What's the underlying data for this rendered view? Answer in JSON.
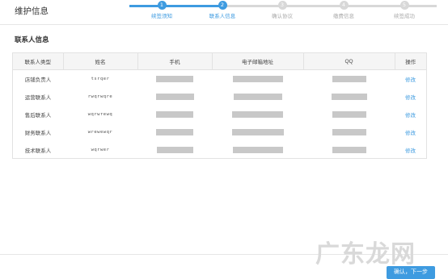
{
  "header": {
    "title": "维护信息"
  },
  "steps": [
    {
      "num": "1",
      "label": "续签须知",
      "active": true
    },
    {
      "num": "2",
      "label": "联系人信息",
      "active": true
    },
    {
      "num": "3",
      "label": "确认协议",
      "active": false
    },
    {
      "num": "4",
      "label": "缴费信息",
      "active": false
    },
    {
      "num": "5",
      "label": "续签成功",
      "active": false
    }
  ],
  "section": {
    "title": "联系人信息"
  },
  "table": {
    "columns": [
      "联系人类型",
      "姓名",
      "手机",
      "电子邮箱地址",
      "QQ",
      "操作"
    ],
    "rows": [
      {
        "type": "店铺负责人",
        "name": "tsrqer",
        "action": "修改"
      },
      {
        "type": "运营联系人",
        "name": "rwqrwqre",
        "action": "修改"
      },
      {
        "type": "售后联系人",
        "name": "wqrwrewq",
        "action": "修改"
      },
      {
        "type": "财务联系人",
        "name": "wrewewqr",
        "action": "修改"
      },
      {
        "type": "技术联系人",
        "name": "wqrwer",
        "action": "修改"
      }
    ]
  },
  "footer": {
    "next_label": "确认，下一步"
  },
  "watermark": {
    "text": "广东龙网"
  },
  "colors": {
    "accent": "#3e9be0",
    "redaction": "#c8c8c8"
  }
}
